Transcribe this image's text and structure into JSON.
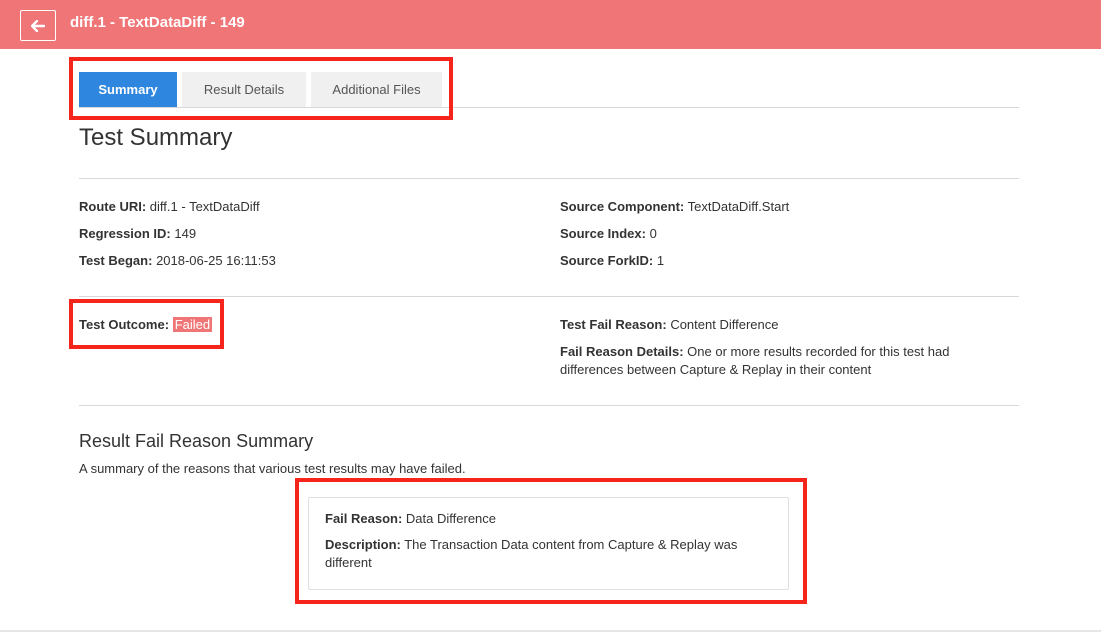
{
  "header": {
    "title": "diff.1 - TextDataDiff - 149",
    "back_icon": "arrow-left-icon"
  },
  "tabs": [
    {
      "label": "Summary",
      "active": true
    },
    {
      "label": "Result Details",
      "active": false
    },
    {
      "label": "Additional Files",
      "active": false
    }
  ],
  "summary": {
    "title": "Test Summary",
    "route_uri": {
      "label": "Route URI:",
      "value": "diff.1 - TextDataDiff"
    },
    "regression_id": {
      "label": "Regression ID:",
      "value": "149"
    },
    "test_began": {
      "label": "Test Began:",
      "value": "2018-06-25 16:11:53"
    },
    "source_component": {
      "label": "Source Component:",
      "value": "TextDataDiff.Start"
    },
    "source_index": {
      "label": "Source Index:",
      "value": "0"
    },
    "source_forkid": {
      "label": "Source ForkID:",
      "value": "1"
    }
  },
  "outcome": {
    "label": "Test Outcome:",
    "value": "Failed",
    "fail_reason_label": "Test Fail Reason:",
    "fail_reason_value": "Content Difference",
    "details_label": "Fail Reason Details:",
    "details_value": "One or more results recorded for this test had differences between Capture & Replay in their content"
  },
  "result_summary": {
    "title": "Result Fail Reason Summary",
    "description": "A summary of the reasons that various test results may have failed.",
    "card": {
      "fail_reason_label": "Fail Reason:",
      "fail_reason_value": "Data Difference",
      "description_label": "Description:",
      "description_value": "The Transaction Data content from Capture & Replay was different"
    }
  },
  "colors": {
    "header_bg": "#f07577",
    "active_tab": "#2e86de",
    "highlight": "#f5251b"
  }
}
